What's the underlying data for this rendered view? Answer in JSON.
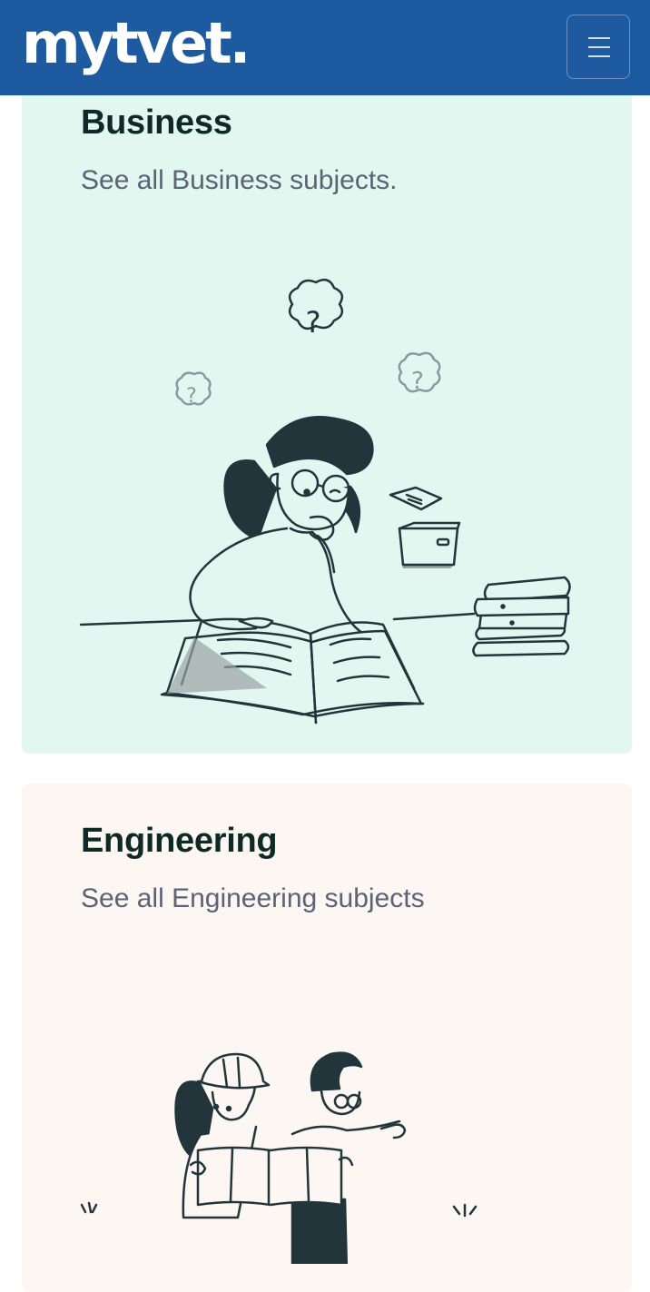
{
  "header": {
    "brand": "mytvet.",
    "menu_icon": "hamburger-icon"
  },
  "cards": [
    {
      "title": "Business",
      "subtitle": "See all Business subjects.",
      "background": "#e3f7f1",
      "illustration_icon": "student-reading-book-illustration"
    },
    {
      "title": "Engineering",
      "subtitle": "See all Engineering subjects",
      "background": "#fcf7f2",
      "illustration_icon": "engineers-reading-blueprint-illustration"
    }
  ],
  "colors": {
    "navbar": "#1e5aa0",
    "title": "#0f2a25",
    "subtitle": "#5b6375",
    "ink": "#22353a"
  }
}
